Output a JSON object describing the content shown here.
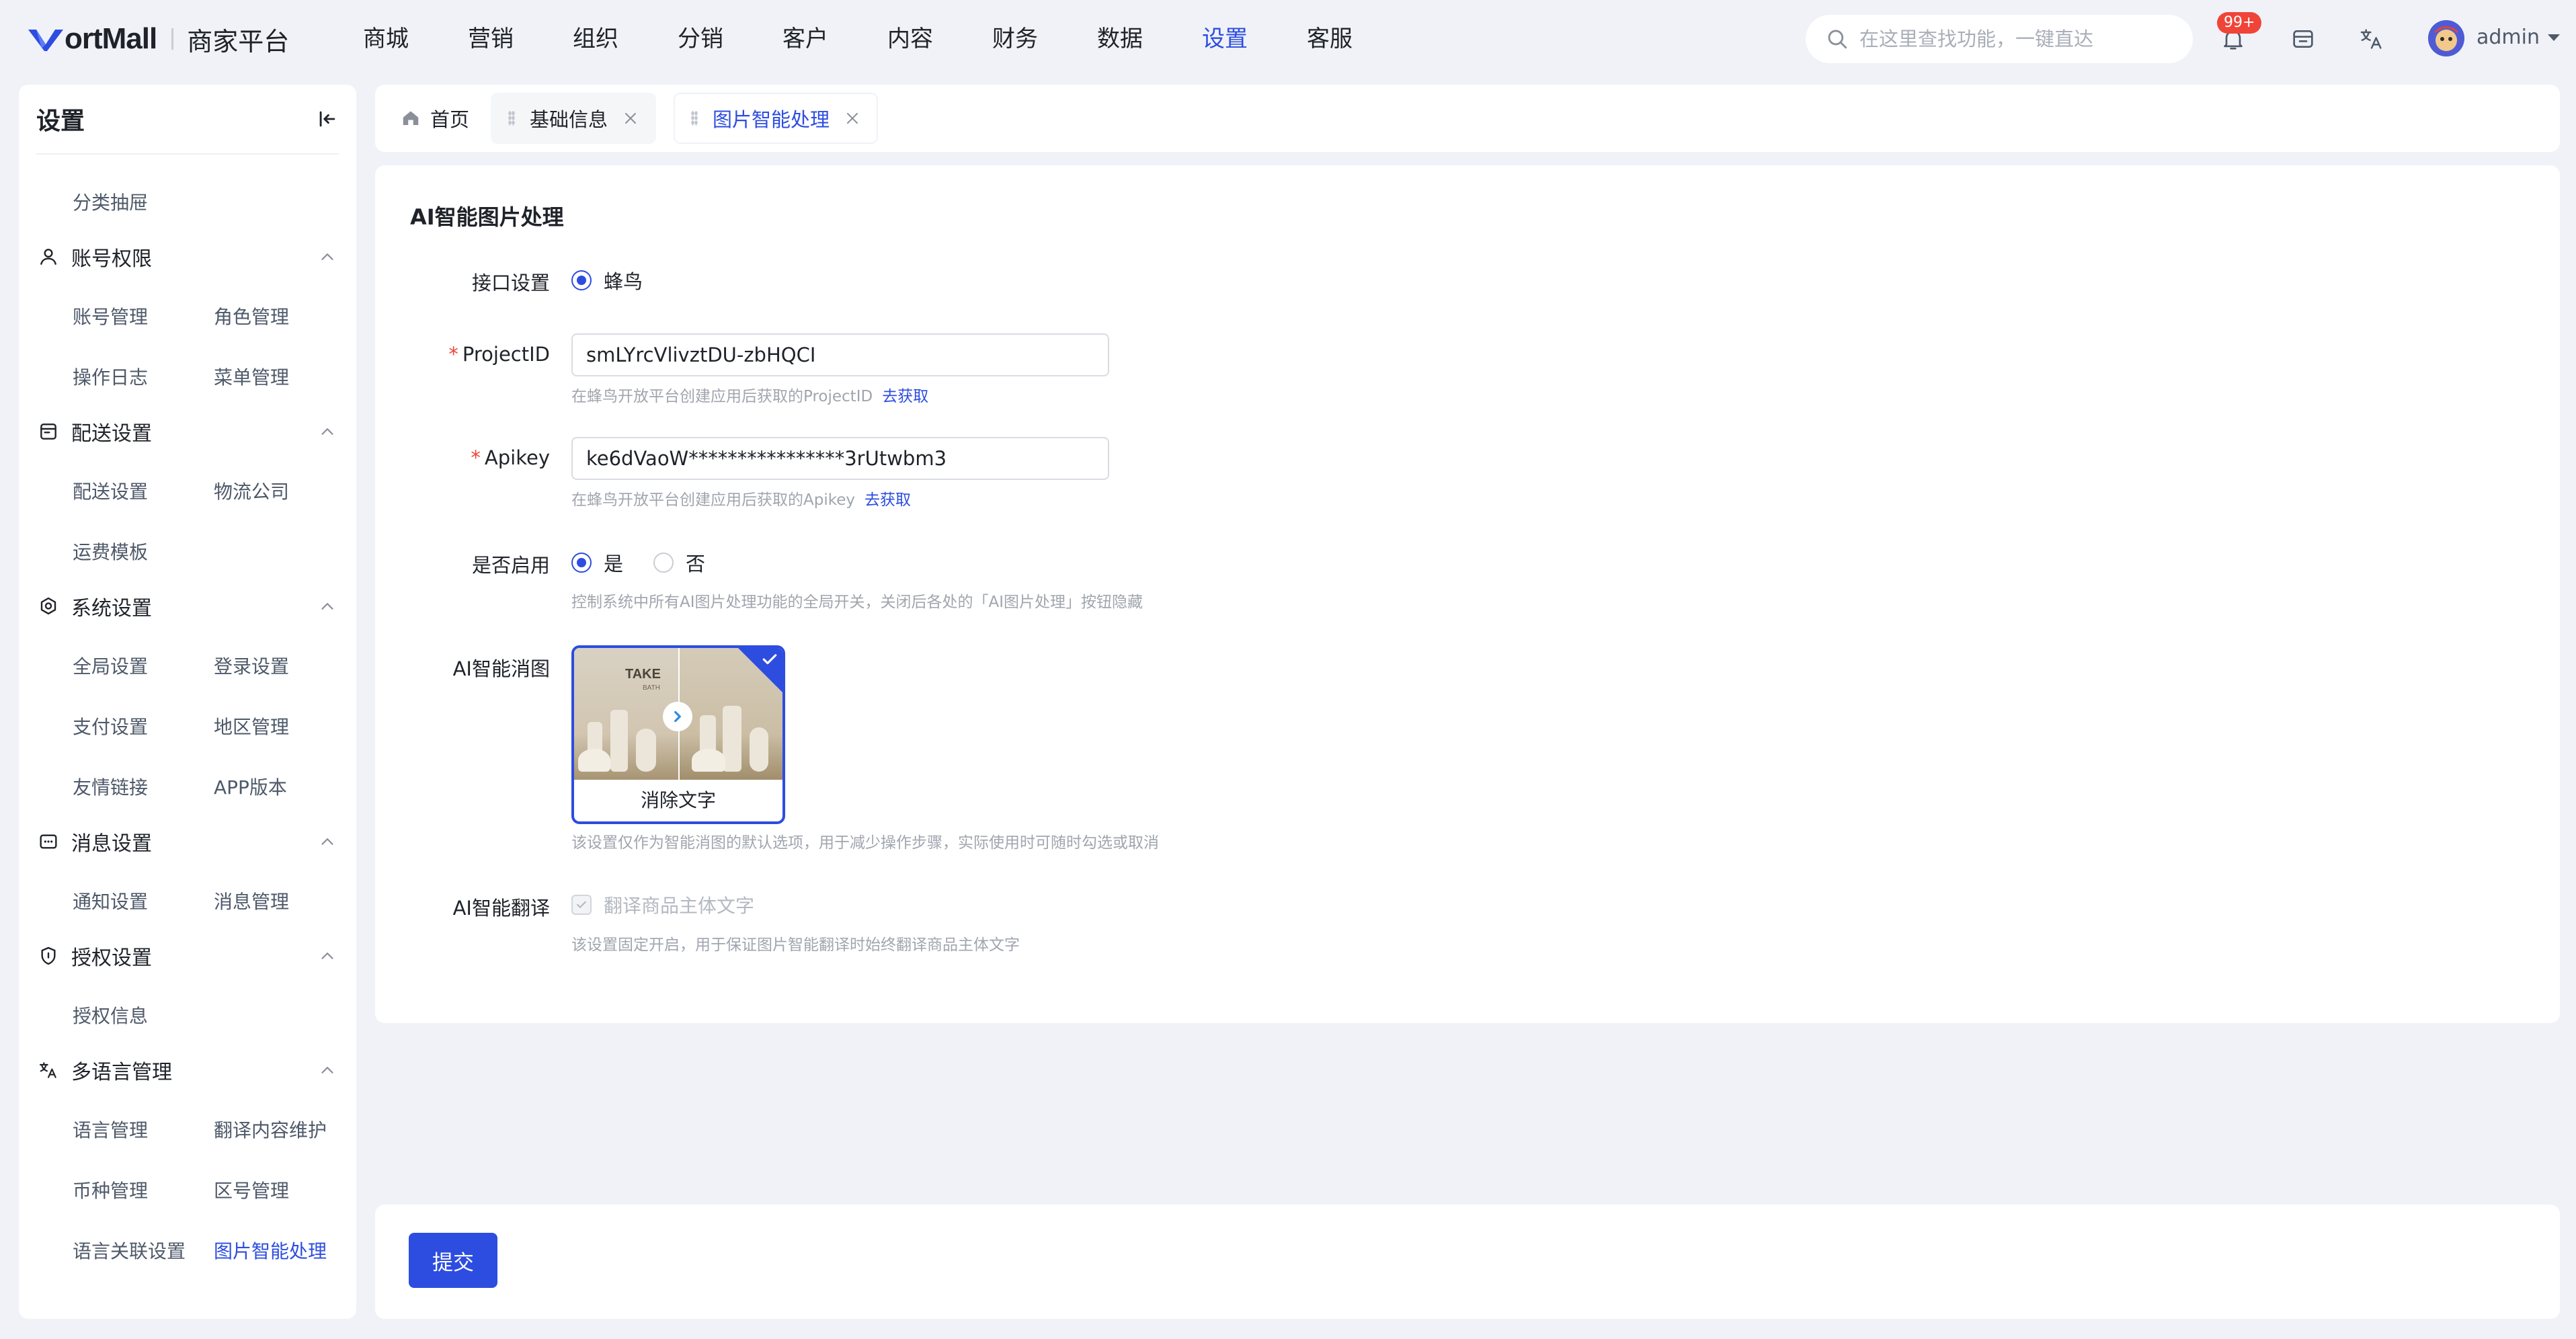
{
  "header": {
    "logo_text": "ortMall",
    "logo_sub": "商家平台",
    "nav": [
      "商城",
      "营销",
      "组织",
      "分销",
      "客户",
      "内容",
      "财务",
      "数据",
      "设置",
      "客服"
    ],
    "nav_active": "设置",
    "search_placeholder": "在这里查找功能，一键直达",
    "notification_badge": "99+",
    "user_name": "admin",
    "icons": [
      "search-icon",
      "bell-icon",
      "store-icon",
      "translate-icon",
      "chevron-down-icon"
    ]
  },
  "sidebar": {
    "title": "设置",
    "top_item": "分类抽屉",
    "groups": [
      {
        "title": "账号权限",
        "icon": "user-icon",
        "items": [
          "账号管理",
          "角色管理",
          "操作日志",
          "菜单管理"
        ]
      },
      {
        "title": "配送设置",
        "icon": "delivery-icon",
        "items": [
          "配送设置",
          "物流公司",
          "运费模板"
        ]
      },
      {
        "title": "系统设置",
        "icon": "settings-icon",
        "items": [
          "全局设置",
          "登录设置",
          "支付设置",
          "地区管理",
          "友情链接",
          "APP版本"
        ]
      },
      {
        "title": "消息设置",
        "icon": "message-icon",
        "items": [
          "通知设置",
          "消息管理"
        ]
      },
      {
        "title": "授权设置",
        "icon": "shield-icon",
        "items": [
          "授权信息"
        ]
      },
      {
        "title": "多语言管理",
        "icon": "translate-icon",
        "items": [
          "语言管理",
          "翻译内容维护",
          "币种管理",
          "区号管理",
          "语言关联设置",
          "图片智能处理"
        ]
      }
    ],
    "active_item": "图片智能处理"
  },
  "tabs": [
    {
      "label": "首页",
      "icon": "home-icon"
    },
    {
      "label": "基础信息",
      "closable": true
    },
    {
      "label": "图片智能处理",
      "closable": true,
      "active": true
    }
  ],
  "form": {
    "title": "AI智能图片处理",
    "interface_label": "接口设置",
    "interface_option": "蜂鸟",
    "project_id_label": "ProjectID",
    "project_id_value": "smLYrcVlivztDU-zbHQCI",
    "project_id_hint": "在蜂鸟开放平台创建应用后获取的ProjectID",
    "apikey_label": "Apikey",
    "apikey_value": "ke6dVaoW****************3rUtwbm3",
    "apikey_hint": "在蜂鸟开放平台创建应用后获取的Apikey",
    "get_link": "去获取",
    "enable_label": "是否启用",
    "enable_yes": "是",
    "enable_no": "否",
    "enable_value": "是",
    "enable_hint": "控制系统中所有AI图片处理功能的全局开关，关闭后各处的「AI图片处理」按钮隐藏",
    "erase_label": "AI智能消图",
    "erase_option": "消除文字",
    "erase_image_text": "TAKE",
    "erase_image_subtext": "BATH",
    "erase_hint": "该设置仅作为智能消图的默认选项，用于减少操作步骤，实际使用时可随时勾选或取消",
    "translate_label": "AI智能翻译",
    "translate_option": "翻译商品主体文字",
    "translate_hint": "该设置固定开启，用于保证图片智能翻译时始终翻译商品主体文字"
  },
  "footer": {
    "submit_label": "提交"
  },
  "colors": {
    "primary": "#2d4de0",
    "danger": "#f04438",
    "background": "#f0f2f7"
  }
}
